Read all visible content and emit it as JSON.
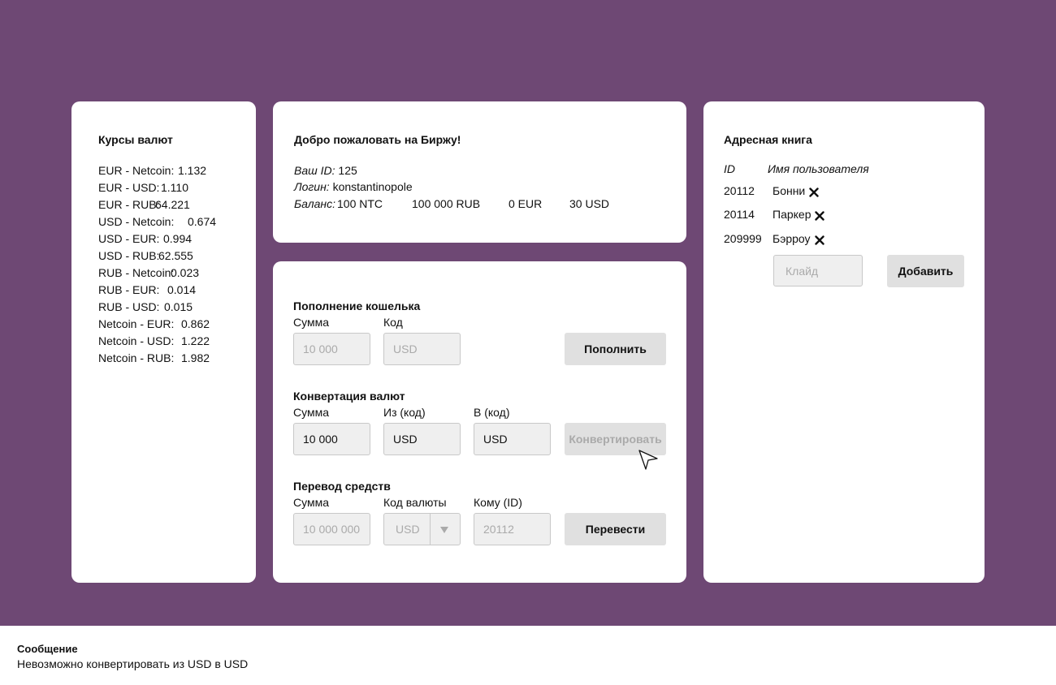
{
  "rates": {
    "title": "Курсы валют",
    "items": [
      {
        "pair": "EUR - Netcoin:",
        "value": "1.132"
      },
      {
        "pair": "EUR - USD:",
        "value": "1.110"
      },
      {
        "pair": "EUR - RUB:",
        "value": "64.221"
      },
      {
        "pair": "USD - Netcoin:",
        "value": "0.674"
      },
      {
        "pair": "USD - EUR:",
        "value": "0.994"
      },
      {
        "pair": "USD - RUB:",
        "value": "62.555"
      },
      {
        "pair": "RUB - Netcoin:",
        "value": "0.023"
      },
      {
        "pair": "RUB - EUR:",
        "value": "0.014"
      },
      {
        "pair": "RUB - USD:",
        "value": "0.015"
      },
      {
        "pair": "Netcoin - EUR:",
        "value": "0.862"
      },
      {
        "pair": "Netcoin - USD:",
        "value": "1.222"
      },
      {
        "pair": "Netcoin - RUB:",
        "value": "1.982"
      }
    ]
  },
  "welcome": {
    "title": "Добро пожаловать на Биржу!",
    "id_label": "Ваш ID:",
    "id_value": "125",
    "login_label": "Логин:",
    "login_value": "konstantinopole",
    "balance_label": "Баланс:",
    "balances": [
      "100 NTC",
      "100 000 RUB",
      "0 EUR",
      "30 USD"
    ]
  },
  "deposit": {
    "title": "Пополнение кошелька",
    "amount_label": "Сумма",
    "code_label": "Код",
    "amount_placeholder": "10 000",
    "code_placeholder": "USD",
    "button": "Пополнить"
  },
  "convert": {
    "title": "Конвертация валют",
    "amount_label": "Сумма",
    "from_label": "Из (код)",
    "to_label": "В (код)",
    "amount_value": "10 000",
    "from_value": "USD",
    "to_value": "USD",
    "button": "Конвертировать"
  },
  "transfer": {
    "title": "Перевод средств",
    "amount_label": "Сумма",
    "currency_label": "Код валюты",
    "to_label": "Кому (ID)",
    "amount_placeholder": "10 000 000",
    "currency_value": "USD",
    "to_placeholder": "20112",
    "button": "Перевести"
  },
  "address_book": {
    "title": "Адресная книга",
    "col_id": "ID",
    "col_name": "Имя пользователя",
    "entries": [
      {
        "id": "20112",
        "name": "Бонни"
      },
      {
        "id": "20114",
        "name": "Паркер"
      },
      {
        "id": "209999",
        "name": "Бэрроу"
      }
    ],
    "name_placeholder": "Клайд",
    "add_button": "Добавить"
  },
  "message": {
    "title": "Сообщение",
    "text": "Невозможно конвертировать из USD в USD"
  }
}
